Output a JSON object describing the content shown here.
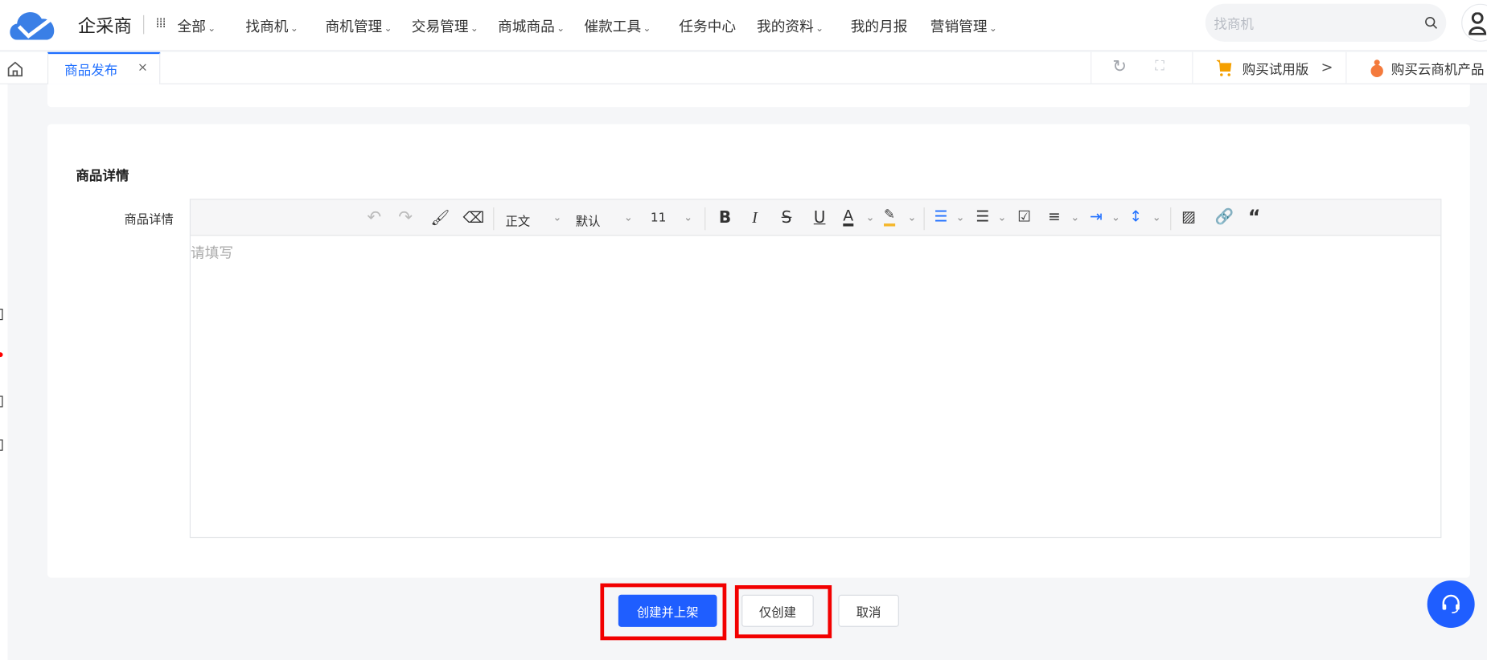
{
  "brand": {
    "name": "企采商"
  },
  "nav": {
    "all": "全部",
    "items": [
      "找商机",
      "商机管理",
      "交易管理",
      "商城商品",
      "催款工具",
      "任务中心",
      "我的资料",
      "我的月报",
      "营销管理"
    ],
    "dropdown": [
      true,
      true,
      true,
      true,
      true,
      false,
      true,
      false,
      true
    ]
  },
  "search": {
    "placeholder": "找商机"
  },
  "tabs": [
    {
      "label": "商品发布",
      "close": "×"
    }
  ],
  "tabbar_right": {
    "trial": "购买试用版",
    "trial_arrow": ">",
    "cloud": "购买云商机产品"
  },
  "section": {
    "title": "商品详情",
    "field_label": "商品详情",
    "placeholder": "请填写"
  },
  "toolbar": {
    "paragraph": "正文",
    "font": "默认",
    "size": "11"
  },
  "buttons": {
    "create_publish": "创建并上架",
    "create_only": "仅创建",
    "cancel": "取消"
  },
  "colors": {
    "primary": "#1f5eff",
    "highlight": "#f5a623",
    "red": "#f20000"
  }
}
